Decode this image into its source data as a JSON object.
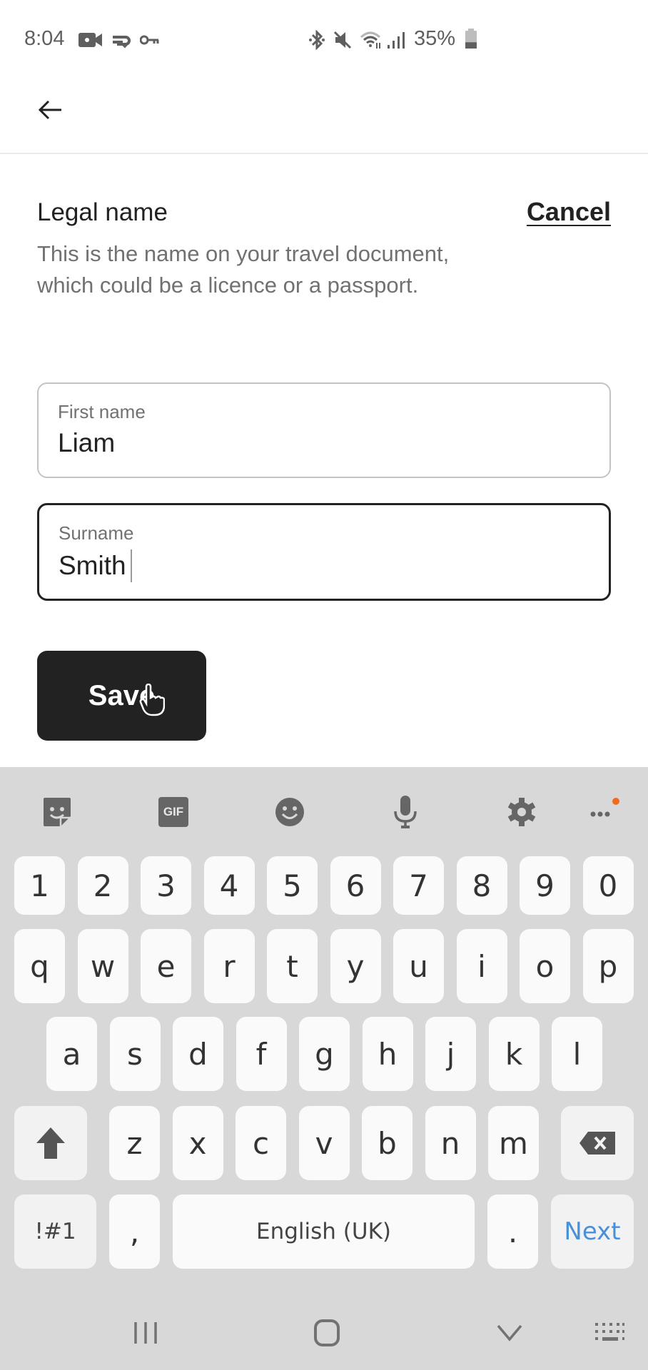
{
  "status_bar": {
    "time": "8:04",
    "left_icons": [
      "video-camera-icon",
      "sync-check-icon",
      "vpn-key-icon"
    ],
    "right_icons": [
      "bluetooth-icon",
      "mute-icon",
      "wifi-icon",
      "signal-icon"
    ],
    "battery_percent_label": "35%",
    "battery_level": 0.35
  },
  "header": {
    "back_icon": "arrow-left-icon"
  },
  "form": {
    "title": "Legal name",
    "cancel_label": "Cancel",
    "description": "This is the name on your travel document, which could be a licence or a passport.",
    "fields": [
      {
        "label": "First name",
        "value": "Liam",
        "focused": false
      },
      {
        "label": "Surname",
        "value": "Smith",
        "focused": true
      }
    ],
    "save_label": "Save"
  },
  "keyboard": {
    "toolbar": [
      "sticker-icon",
      "gif-icon",
      "emoji-icon",
      "microphone-icon",
      "settings-gear-icon",
      "more-options-icon"
    ],
    "gif_label": "GIF",
    "number_row": [
      "1",
      "2",
      "3",
      "4",
      "5",
      "6",
      "7",
      "8",
      "9",
      "0"
    ],
    "row1": [
      "q",
      "w",
      "e",
      "r",
      "t",
      "y",
      "u",
      "i",
      "o",
      "p"
    ],
    "row2": [
      "a",
      "s",
      "d",
      "f",
      "g",
      "h",
      "j",
      "k",
      "l"
    ],
    "row3": [
      "z",
      "x",
      "c",
      "v",
      "b",
      "n",
      "m"
    ],
    "symbols_label": "!#1",
    "comma_label": ",",
    "space_label": "English (UK)",
    "period_label": ".",
    "action_label": "Next",
    "notification_dot_color": "#f26b1d",
    "action_color": "#4a90d9"
  },
  "nav_bar": {
    "buttons": [
      "recent-apps-icon",
      "home-icon",
      "hide-keyboard-icon",
      "keyboard-switch-icon"
    ]
  }
}
